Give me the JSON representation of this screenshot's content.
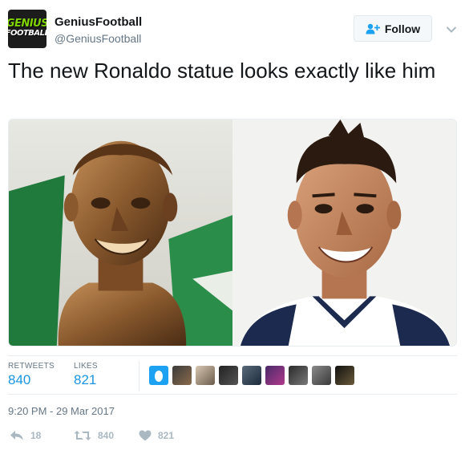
{
  "account": {
    "avatar_line1": "GENIUS",
    "avatar_line2": "FOOTBALL",
    "name": "GeniusFootball",
    "handle": "@GeniusFootball"
  },
  "follow_button": {
    "label": "Follow"
  },
  "tweet": {
    "text": "The new Ronaldo statue looks exactly like him"
  },
  "stats": {
    "retweets_label": "RETWEETS",
    "retweets_value": "840",
    "likes_label": "LIKES",
    "likes_value": "821"
  },
  "timestamp": "9:20 PM - 29 Mar 2017",
  "actions": {
    "reply_count": "18",
    "retweet_count": "840",
    "like_count": "821"
  },
  "colors": {
    "link_blue": "#1b95e0",
    "muted": "#657786",
    "icon_grey": "#aab8c2",
    "avatar_green": "#7fd300"
  },
  "icons": [
    "follow-user-icon",
    "chevron-down-icon",
    "reply-icon",
    "retweet-icon",
    "heart-icon"
  ]
}
